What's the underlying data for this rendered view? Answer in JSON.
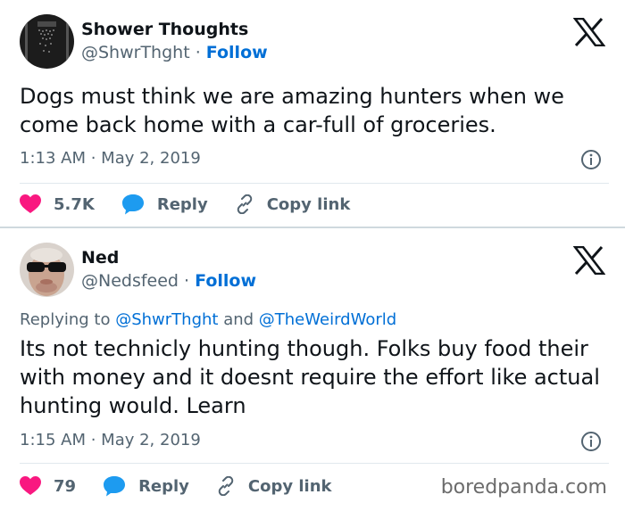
{
  "tweets": [
    {
      "name": "Shower Thoughts",
      "handle": "@ShwrThght",
      "separator": " · ",
      "follow_label": "Follow",
      "text": "Dogs must think we are amazing hunters when we come back home with a car-full of groceries.",
      "time": "1:13 AM",
      "date": "May 2, 2019",
      "time_sep": " · ",
      "likes": "5.7K",
      "reply_label": "Reply",
      "copy_label": "Copy link"
    },
    {
      "name": "Ned",
      "handle": "@Nedsfeed",
      "separator": " · ",
      "follow_label": "Follow",
      "replying_prefix": "Replying to ",
      "reply_mention_1": "@ShwrThght",
      "replying_and": " and ",
      "reply_mention_2": "@TheWeirdWorld",
      "text": "Its not technicly hunting though. Folks buy food their with money and it doesnt require the effort like actual hunting would. Learn",
      "time": "1:15 AM",
      "date": "May 2, 2019",
      "time_sep": " · ",
      "likes": "79",
      "reply_label": "Reply",
      "copy_label": "Copy link"
    }
  ],
  "watermark": "boredpanda.com",
  "colors": {
    "text": "#0f1419",
    "muted": "#536471",
    "link": "#006fd6",
    "like": "#f91880",
    "reply": "#1d9bf0"
  }
}
